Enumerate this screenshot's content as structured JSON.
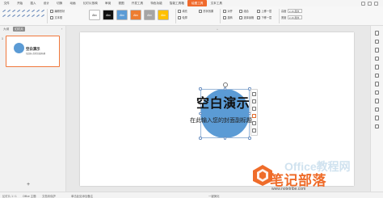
{
  "menu": {
    "items": [
      {
        "label": "文件"
      },
      {
        "label": "开始"
      },
      {
        "label": "插入"
      },
      {
        "label": "设计"
      },
      {
        "label": "切换"
      },
      {
        "label": "动画"
      },
      {
        "label": "幻灯片放映"
      },
      {
        "label": "审阅"
      },
      {
        "label": "视图"
      },
      {
        "label": "开发工具"
      },
      {
        "label": "特色功能"
      },
      {
        "label": "智能工具箱"
      },
      {
        "label": "绘图工具",
        "active": true
      },
      {
        "label": "文本工具"
      }
    ]
  },
  "ribbon": {
    "edit_shape": "编辑形状",
    "text_box": "文本框",
    "styles": [
      "Abc",
      "Abc",
      "Abc",
      "Abc",
      "Abc",
      "Abc"
    ],
    "fill": "填充",
    "outline": "轮廓",
    "shape_effects": "形状效果",
    "align": "对齐",
    "rotate": "旋转",
    "group": "组合",
    "up_one": "上移一层",
    "down_one": "下移一层",
    "selection_pane": "选择窗格",
    "height_label": "高度",
    "width_label": "宽度",
    "height_value": "2.16 厘米",
    "width_value": "2.16 厘米"
  },
  "left_panel": {
    "tab_outline": "大纲",
    "tab_slides": "幻灯片",
    "slide_number": "1",
    "thumb_title": "空白演示",
    "thumb_sub": "在此输入您的封面副标题",
    "add": "+"
  },
  "slide": {
    "title": "空白演示",
    "subtitle": "在此输入您的封面副标题",
    "shape_color": "#5B9BD5"
  },
  "status": {
    "slide_info": "幻灯片 1 / 1",
    "theme": "Office 主题",
    "doc_hint": "文档未保护",
    "notes": "单击此处添加备注",
    "zoom_label": "一键美化",
    "collapse": "^"
  },
  "watermark": {
    "main": "笔记部落",
    "url": "www.notetribe.com",
    "office": "Office教程网"
  },
  "colors": {
    "accent": "#F06A2C",
    "shape_blue": "#5B9BD5"
  }
}
